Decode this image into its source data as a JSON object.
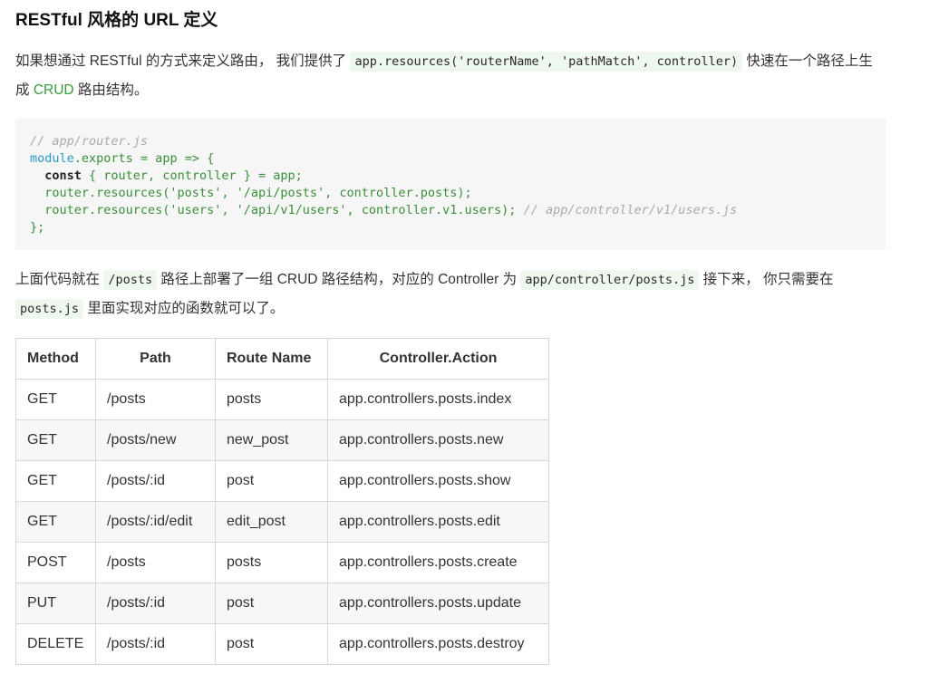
{
  "title": "RESTful 风格的 URL 定义",
  "intro": {
    "text_a": "如果想通过 RESTful 的方式来定义路由， 我们提供了 ",
    "code": "app.resources('routerName', 'pathMatch', controller)",
    "text_b": " 快速在一个路径上生成 ",
    "crud": "CRUD",
    "text_c": " 路由结构。"
  },
  "code_block": {
    "line1": "// app/router.js",
    "line2_kw": "module",
    "line2_rest": ".exports = app => {",
    "line3_kw": "  const",
    "line3_rest": " { router, controller } = app;",
    "line4": "  router.resources('posts', '/api/posts', controller.posts);",
    "line5": "  router.resources('users', '/api/v1/users', controller.v1.users);",
    "line5_comment": " // app/controller/v1/users.js",
    "line6": "};"
  },
  "explain": {
    "text_a": "上面代码就在 ",
    "code_a": "/posts",
    "text_b": " 路径上部署了一组 CRUD 路径结构，对应的 Controller 为 ",
    "code_b": "app/controller/posts.js",
    "text_c": " 接下来， 你只需要在 ",
    "code_c": "posts.js",
    "text_d": " 里面实现对应的函数就可以了。"
  },
  "table": {
    "headers": [
      "Method",
      "Path",
      "Route Name",
      "Controller.Action"
    ],
    "rows": [
      [
        "GET",
        "/posts",
        "posts",
        "app.controllers.posts.index"
      ],
      [
        "GET",
        "/posts/new",
        "new_post",
        "app.controllers.posts.new"
      ],
      [
        "GET",
        "/posts/:id",
        "post",
        "app.controllers.posts.show"
      ],
      [
        "GET",
        "/posts/:id/edit",
        "edit_post",
        "app.controllers.posts.edit"
      ],
      [
        "POST",
        "/posts",
        "posts",
        "app.controllers.posts.create"
      ],
      [
        "PUT",
        "/posts/:id",
        "post",
        "app.controllers.posts.update"
      ],
      [
        "DELETE",
        "/posts/:id",
        "post",
        "app.controllers.posts.destroy"
      ]
    ]
  }
}
